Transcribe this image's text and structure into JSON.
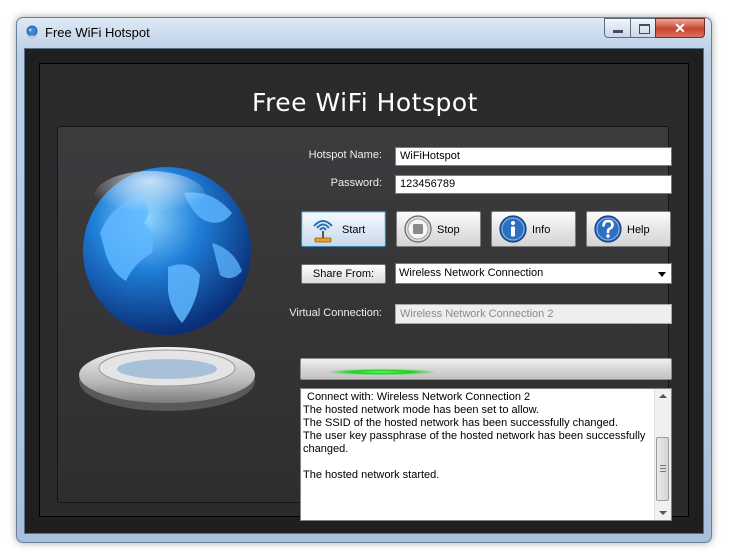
{
  "window": {
    "title": "Free WiFi Hotspot",
    "close_glyph": "✕"
  },
  "header": {
    "title": "Free WiFi Hotspot"
  },
  "form": {
    "hotspot_name_label": "Hotspot Name:",
    "hotspot_name_value": "WiFiHotspot",
    "password_label": "Password:",
    "password_value": "123456789"
  },
  "buttons": {
    "start": "Start",
    "stop": "Stop",
    "info": "Info",
    "help": "Help"
  },
  "share": {
    "button_label": "Share From:",
    "selected": "Wireless Network Connection"
  },
  "virtual": {
    "label": "Virtual Connection:",
    "value": "Wireless Network Connection 2"
  },
  "log": {
    "lines": [
      "Connect with: Wireless Network Connection 2",
      "The hosted network mode has been set to allow.",
      "The SSID of the hosted network has been successfully changed.",
      "The user key passphrase of the hosted network has been successfully changed.",
      "",
      "The hosted network started."
    ]
  },
  "icons": {
    "app": "globe-icon",
    "globe": "globe-graphic",
    "start": "wifi-antenna-icon",
    "stop": "stop-icon",
    "info": "info-icon",
    "help": "help-icon",
    "dropdown": "chevron-down-icon"
  },
  "colors": {
    "accent_blue": "#2f6fc0",
    "progress_green": "#18d418",
    "panel_dark": "#2b2b2d"
  }
}
